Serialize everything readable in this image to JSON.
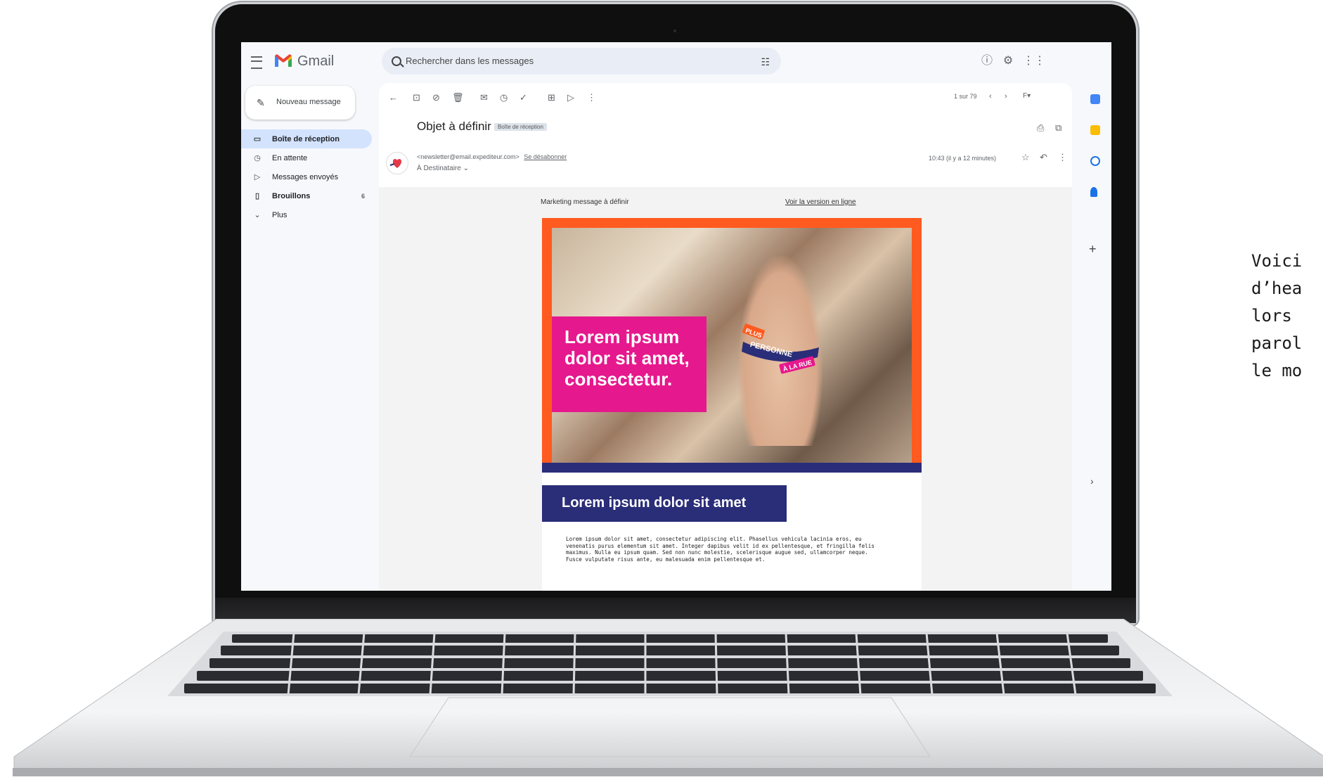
{
  "side_caption": "Voici\nd’hea\nlors \nparol\nle mo",
  "gmail": {
    "app_name": "Gmail",
    "search_placeholder": "Rechercher dans les messages",
    "compose_label": "Nouveau message",
    "nav": [
      {
        "label": "Boîte de réception",
        "icon": "inbox-icon",
        "count": "",
        "active": true
      },
      {
        "label": "En attente",
        "icon": "clock-icon",
        "count": ""
      },
      {
        "label": "Messages envoyés",
        "icon": "send-icon",
        "count": ""
      },
      {
        "label": "Brouillons",
        "icon": "draft-icon",
        "count": "6"
      },
      {
        "label": "Plus",
        "icon": "chevron-down-icon",
        "count": ""
      }
    ],
    "pager": "1 sur 79",
    "subject": "Objet à définir",
    "label_chip": "Boîte de réception",
    "sender_email": "<newsletter@email.expediteur.com>",
    "unsubscribe": "Se désabonner",
    "recipient": "À Destinataire",
    "time": "10:43 (il y a 12 minutes)"
  },
  "email": {
    "preheader": "Marketing message à définir",
    "web_version": "Voir la version en ligne",
    "hero_title": "Lorem ipsum dolor sit amet, consectetur.",
    "sticker_lines": [
      "PLUS",
      "PERSONNE",
      "À LA RUE"
    ],
    "section_title": "Lorem ipsum dolor sit amet",
    "body_text": "Lorem ipsum dolor sit amet, consectetur adipiscing elit. Phasellus vehicula lacinia eros, eu venenatis purus elementum sit amet. Integer dapibus velit id ex pellentesque, et fringilla felis maximus. Nulla eu ipsum quam. Sed non nunc molestie, scelerisque augue sed, ullamcorper neque. Fusce vulputate risus ante, eu malesuada enim pellentesque et."
  },
  "colors": {
    "hero_orange": "#ff5a1f",
    "hero_pink": "#e6188d",
    "navy": "#2a2d78"
  }
}
